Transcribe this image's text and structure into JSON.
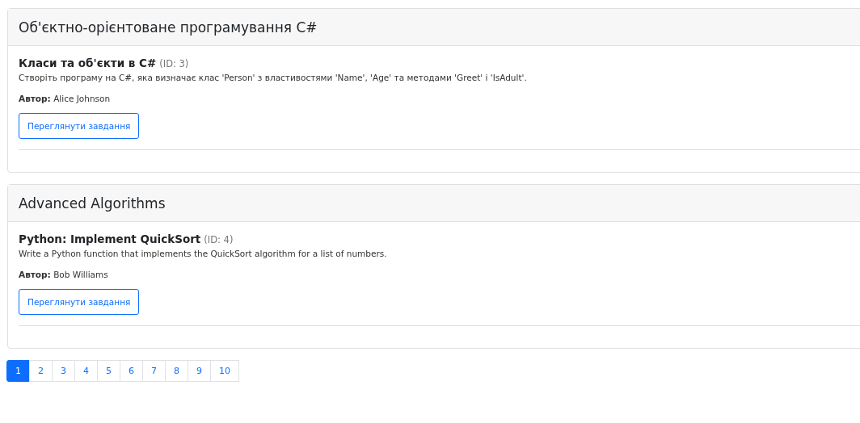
{
  "courses": [
    {
      "title": "Об'єктно-орієнтоване програмування C#",
      "tasks": [
        {
          "title": "Класи та об'єкти в C#",
          "id": "(ID: 3)",
          "description": "Створіть програму на C#, яка визначає клас 'Person' з властивостями 'Name', 'Age' та методами 'Greet' і 'IsAdult'.",
          "author": "**Автор:** Alice Johnson",
          "button": "Переглянути завдання"
        }
      ]
    },
    {
      "title": "Advanced Algorithms",
      "tasks": [
        {
          "title": "Python: Implement QuickSort",
          "id": "(ID: 4)",
          "description": "Write a Python function that implements the QuickSort algorithm for a list of numbers.",
          "author": "**Автор:** Bob Williams",
          "button": "Переглянути завдання"
        }
      ]
    }
  ],
  "pagination": [
    {
      "label": "1",
      "selected": true
    },
    {
      "label": "2",
      "selected": false
    },
    {
      "label": "3",
      "selected": false
    },
    {
      "label": "4",
      "selected": false
    },
    {
      "label": "5",
      "selected": false
    },
    {
      "label": "6",
      "selected": false
    },
    {
      "label": "7",
      "selected": false
    },
    {
      "label": "8",
      "selected": false
    },
    {
      "label": "9",
      "selected": false
    },
    {
      "label": "10",
      "selected": false
    }
  ]
}
